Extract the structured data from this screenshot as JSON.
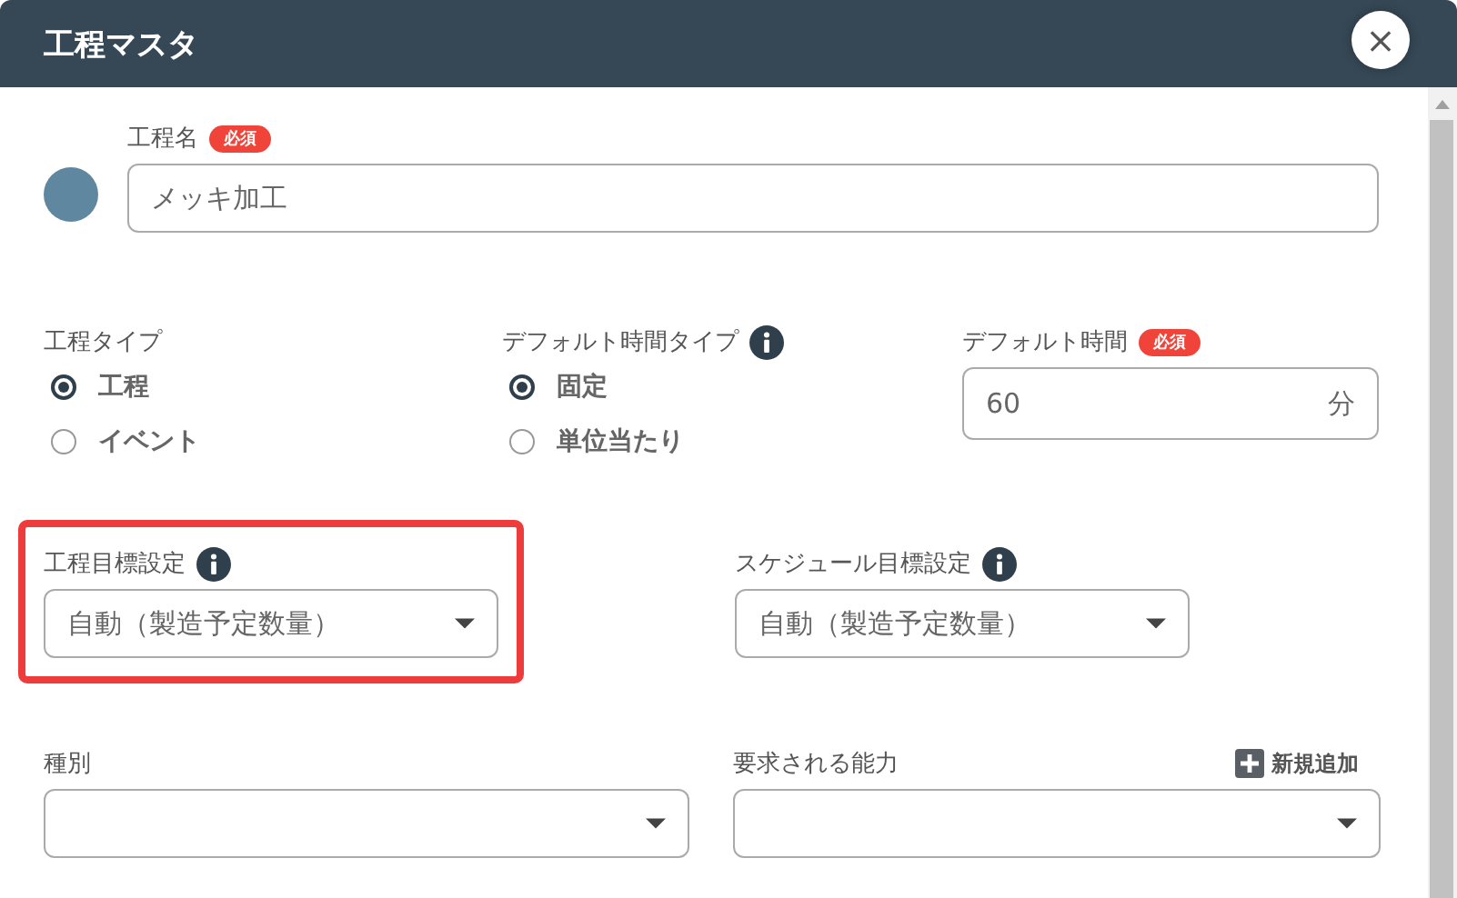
{
  "window": {
    "title": "工程マスタ",
    "close": "×"
  },
  "process_name": {
    "label": "工程名",
    "required": "必須",
    "value": "メッキ加工",
    "color": "#5f88a0"
  },
  "process_type": {
    "label": "工程タイプ",
    "options": [
      {
        "label": "工程",
        "selected": true
      },
      {
        "label": "イベント",
        "selected": false
      }
    ]
  },
  "default_time_type": {
    "label": "デフォルト時間タイプ",
    "options": [
      {
        "label": "固定",
        "selected": true
      },
      {
        "label": "単位当たり",
        "selected": false
      }
    ]
  },
  "default_time": {
    "label": "デフォルト時間",
    "required": "必須",
    "value": "60",
    "unit": "分"
  },
  "process_target": {
    "label": "工程目標設定",
    "value": "自動（製造予定数量）",
    "highlighted": true
  },
  "schedule_target": {
    "label": "スケジュール目標設定",
    "value": "自動（製造予定数量）"
  },
  "category": {
    "label": "種別"
  },
  "required_ability": {
    "label": "要求される能力",
    "add_button": "新規追加"
  }
}
